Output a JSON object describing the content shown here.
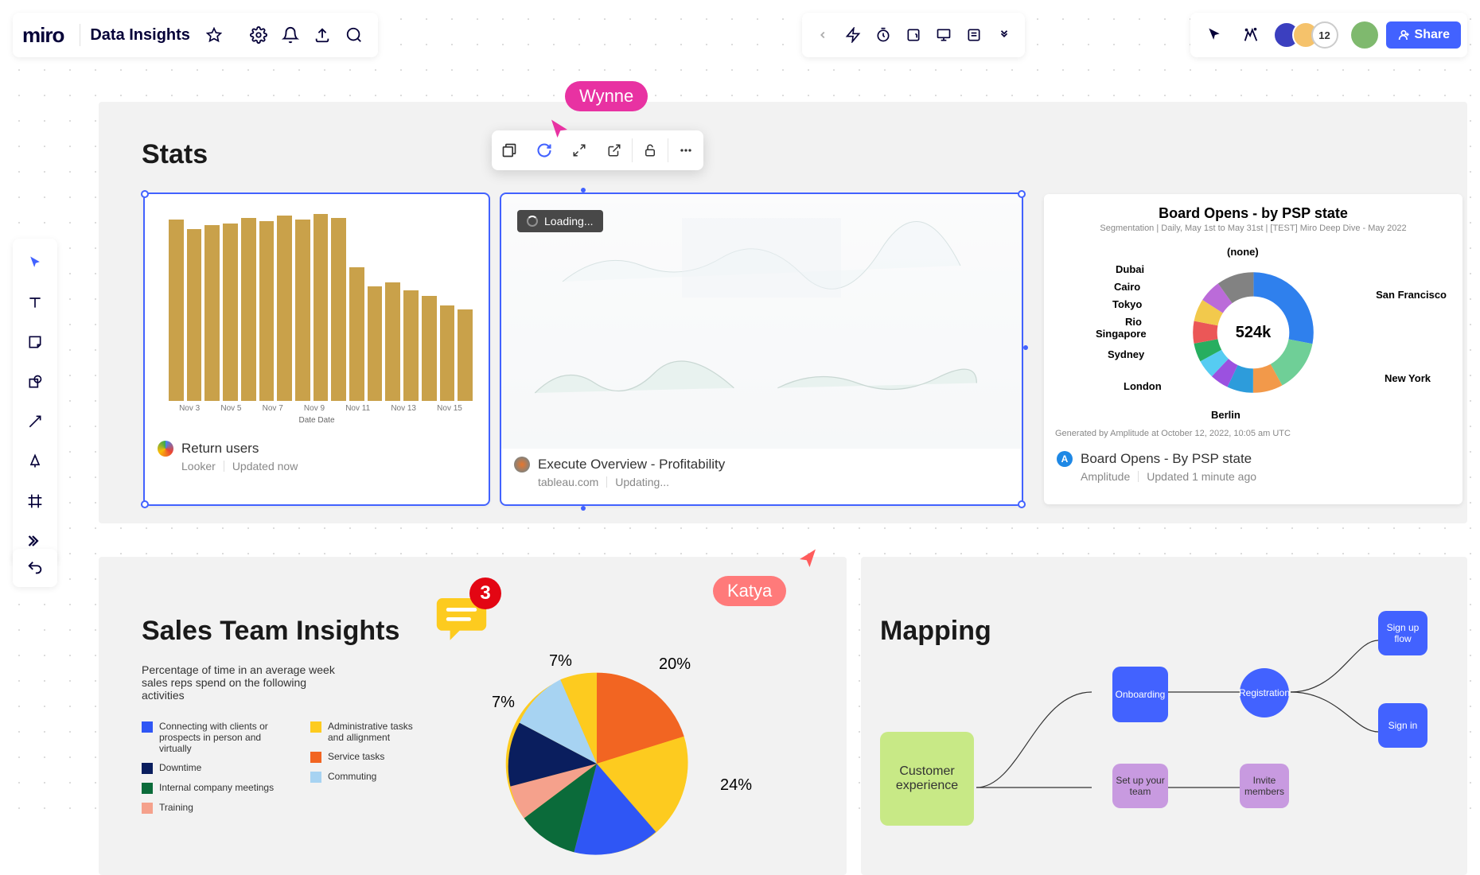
{
  "app": {
    "logo": "miro",
    "board_title": "Data Insights"
  },
  "share_button": "Share",
  "avatar_overflow": "12",
  "cursors": {
    "wynne": "Wynne",
    "katya": "Katya"
  },
  "comment_count": "3",
  "loading_text": "Loading...",
  "sections": {
    "stats": "Stats",
    "sales": "Sales Team Insights",
    "mapping": "Mapping"
  },
  "sales_subtitle": "Percentage of time in an average week sales reps spend on the following activities",
  "cards": {
    "return_users": {
      "title": "Return users",
      "source": "Looker",
      "updated": "Updated now",
      "chart_axis": "Date Date"
    },
    "tableau": {
      "title": "Execute Overview - Profitability",
      "source": "tableau.com",
      "updated": "Updating..."
    },
    "amplitude": {
      "title": "Board Opens - By PSP state",
      "source": "Amplitude",
      "updated": "Updated 1 minute ago",
      "chart_title": "Board Opens - by PSP state",
      "chart_meta": "Segmentation  |  Daily, May 1st to May 31st  |  [TEST] Miro Deep Dive - May 2022",
      "chart_footer": "Generated by Amplitude at October 12, 2022, 10:05 am UTC",
      "center_value": "524k"
    }
  },
  "chart_data": {
    "return_users_bars": {
      "type": "bar",
      "categories": [
        "Nov 3",
        "",
        "Nov 5",
        "",
        "Nov 7",
        "",
        "Nov 9",
        "",
        "Nov 11",
        "",
        "Nov 13",
        "",
        "Nov 15"
      ],
      "values": [
        95,
        90,
        92,
        93,
        96,
        94,
        97,
        95,
        98,
        96,
        70,
        60,
        62,
        58,
        55,
        50,
        48
      ],
      "xlabel": "Date Date"
    },
    "board_opens_donut": {
      "type": "pie",
      "center_label": "524k",
      "slices": [
        {
          "label": "San Francisco",
          "color": "#2F80ED",
          "value": 28
        },
        {
          "label": "New York",
          "color": "#6FCF97",
          "value": 14
        },
        {
          "label": "Berlin",
          "color": "#F2994A",
          "value": 8
        },
        {
          "label": "London",
          "color": "#2D9CDB",
          "value": 7
        },
        {
          "label": "Sydney",
          "color": "#9B51E0",
          "value": 5
        },
        {
          "label": "Singapore",
          "color": "#56CCF2",
          "value": 5
        },
        {
          "label": "Rio",
          "color": "#27AE60",
          "value": 5
        },
        {
          "label": "Tokyo",
          "color": "#EB5757",
          "value": 6
        },
        {
          "label": "Cairo",
          "color": "#F2C94C",
          "value": 6
        },
        {
          "label": "Dubai",
          "color": "#BB6BD9",
          "value": 6
        },
        {
          "label": "(none)",
          "color": "#828282",
          "value": 10
        }
      ]
    },
    "sales_pie": {
      "type": "pie",
      "labels_shown": [
        "7%",
        "7%",
        "20%",
        "24%"
      ],
      "series": [
        {
          "name": "Connecting with clients or prospects in person and virtually",
          "color": "#2F56F5",
          "value": 24
        },
        {
          "name": "Downtime",
          "color": "#0A1E5E",
          "value": 7
        },
        {
          "name": "Internal company meetings",
          "color": "#0B6B3A",
          "value": 10
        },
        {
          "name": "Training",
          "color": "#F5A18C",
          "value": 8
        },
        {
          "name": "Administrative tasks and allignment",
          "color": "#FDCB1F",
          "value": 24
        },
        {
          "name": "Service tasks",
          "color": "#F26522",
          "value": 20
        },
        {
          "name": "Commuting",
          "color": "#A7D3F2",
          "value": 7
        }
      ]
    }
  },
  "sales_legend": [
    {
      "color": "#2F56F5",
      "text": "Connecting with clients or prospects in person and virtually"
    },
    {
      "color": "#0A1E5E",
      "text": "Downtime"
    },
    {
      "color": "#0B6B3A",
      "text": "Internal company meetings"
    },
    {
      "color": "#F5A18C",
      "text": "Training"
    },
    {
      "color": "#FDCB1F",
      "text": "Administrative tasks and allignment"
    },
    {
      "color": "#F26522",
      "text": "Service tasks"
    },
    {
      "color": "#A7D3F2",
      "text": "Commuting"
    }
  ],
  "pie_labels": {
    "a": "7%",
    "b": "7%",
    "c": "20%",
    "d": "24%"
  },
  "mapping_nodes": {
    "customer": "Customer experience",
    "onboarding": "Onboarding",
    "setup": "Set up your team",
    "registration": "Registration",
    "invite": "Invite members",
    "signup": "Sign up flow",
    "signin": "Sign in"
  }
}
